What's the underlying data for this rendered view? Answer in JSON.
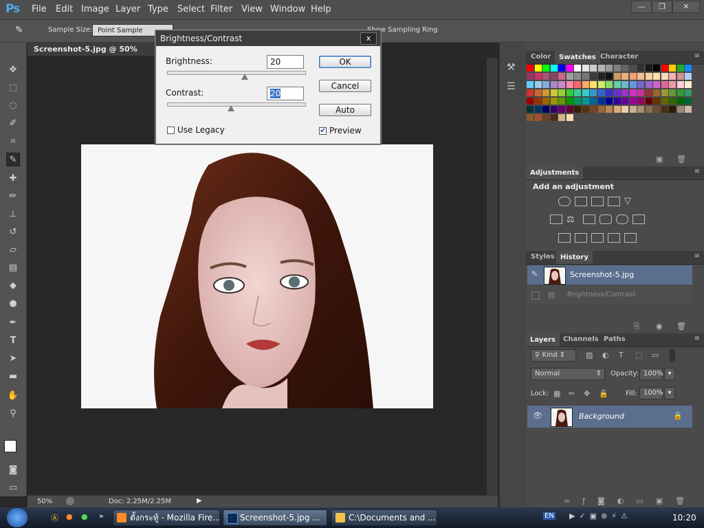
{
  "app": {
    "logo": "Ps"
  },
  "menu": [
    "File",
    "Edit",
    "Image",
    "Layer",
    "Type",
    "Select",
    "Filter",
    "View",
    "Window",
    "Help"
  ],
  "window_buttons": {
    "minimize": "—",
    "restore": "❐",
    "close": "✕"
  },
  "options_bar": {
    "sample_size_label": "Sample Size:",
    "sample_size_value": "Point Sample",
    "sampling_ring_label": "Show Sampling Ring"
  },
  "document": {
    "tab_title": "Screenshot-5.jpg @ 50% (RGB/8)",
    "zoom": "50%",
    "doc_info": "Doc: 2.25M/2.25M"
  },
  "dialog": {
    "title": "Brightness/Contrast",
    "close": "x",
    "brightness_label": "Brightness:",
    "brightness_value": "20",
    "brightness_level": 20,
    "contrast_label": "Contrast:",
    "contrast_value": "20",
    "contrast_level": 20,
    "ok": "OK",
    "cancel": "Cancel",
    "auto": "Auto",
    "use_legacy": "Use Legacy",
    "use_legacy_checked": false,
    "preview": "Preview",
    "preview_checked": true
  },
  "swatch_panel": {
    "tabs": [
      "Color",
      "Swatches",
      "Character"
    ],
    "active": "Swatches"
  },
  "adjustments_panel": {
    "tab": "Adjustments",
    "heading": "Add an adjustment"
  },
  "history_panel": {
    "tabs": [
      "Styles",
      "History"
    ],
    "active": "History",
    "items": [
      "Screenshot-5.jpg",
      "Brightness/Contrast"
    ]
  },
  "layers_panel": {
    "tabs": [
      "Layers",
      "Channels",
      "Paths"
    ],
    "kind": "Kind",
    "blend_mode": "Normal",
    "opacity_label": "Opacity:",
    "opacity_value": "100%",
    "lock_label": "Lock:",
    "fill_label": "Fill:",
    "fill_value": "100%",
    "layer_name": "Background"
  },
  "taskbar": {
    "tasks": [
      "ตั้งกระทู้ - Mozilla Fire...",
      "Screenshot-5.jpg ...",
      "C:\\Documents and ..."
    ],
    "language": "EN",
    "clock": "10:20"
  },
  "colors": {
    "accent": "#4fa8e8",
    "panel": "#4a4a4a",
    "selected_row": "#5b6e8e"
  }
}
